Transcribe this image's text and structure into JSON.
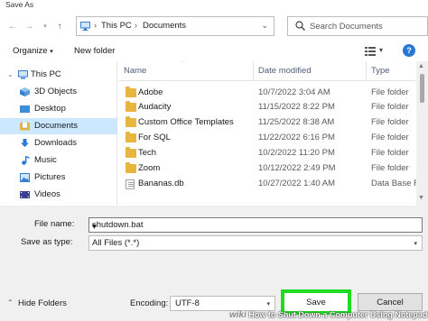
{
  "window": {
    "title": "Save As"
  },
  "address": {
    "crumbs": [
      "This PC",
      "Documents"
    ],
    "search_placeholder": "Search Documents"
  },
  "toolbar": {
    "organize": "Organize",
    "new_folder": "New folder"
  },
  "nav": {
    "items": [
      {
        "label": "This PC",
        "icon": "pc-icon"
      },
      {
        "label": "3D Objects",
        "icon": "cube-folder-icon"
      },
      {
        "label": "Desktop",
        "icon": "desktop-folder-icon"
      },
      {
        "label": "Documents",
        "icon": "documents-folder-icon",
        "selected": true
      },
      {
        "label": "Downloads",
        "icon": "downloads-folder-icon"
      },
      {
        "label": "Music",
        "icon": "music-folder-icon"
      },
      {
        "label": "Pictures",
        "icon": "pictures-folder-icon"
      },
      {
        "label": "Videos",
        "icon": "videos-folder-icon"
      }
    ]
  },
  "columns": {
    "name": "Name",
    "date": "Date modified",
    "type": "Type"
  },
  "files": [
    {
      "name": "Adobe",
      "date": "10/7/2022 3:04 AM",
      "type": "File folder",
      "icon": "folder-icon"
    },
    {
      "name": "Audacity",
      "date": "11/15/2022 8:22 PM",
      "type": "File folder",
      "icon": "folder-icon"
    },
    {
      "name": "Custom Office Templates",
      "date": "11/25/2022 8:38 AM",
      "type": "File folder",
      "icon": "folder-icon"
    },
    {
      "name": "For SQL",
      "date": "11/22/2022 6:16 PM",
      "type": "File folder",
      "icon": "folder-icon"
    },
    {
      "name": "Tech",
      "date": "10/2/2022 11:20 PM",
      "type": "File folder",
      "icon": "folder-icon"
    },
    {
      "name": "Zoom",
      "date": "10/12/2022 2:49 PM",
      "type": "File folder",
      "icon": "folder-icon"
    },
    {
      "name": "Bananas.db",
      "date": "10/27/2022 1:40 AM",
      "type": "Data Base File",
      "icon": "database-file-icon"
    }
  ],
  "form": {
    "file_name_label": "File name:",
    "file_name_value": "shutdown.bat",
    "save_as_type_label": "Save as type:",
    "save_as_type_value": "All Files (*.*)",
    "encoding_label": "Encoding:",
    "encoding_value": "UTF-8"
  },
  "buttons": {
    "hide_folders": "Hide Folders",
    "save": "Save",
    "cancel": "Cancel"
  },
  "watermark": {
    "brand": "wiki",
    "text": "How to Shut Down a Computer Using Notepad"
  },
  "colors": {
    "selected_nav": "#cce8ff",
    "save_highlight": "#1edc21",
    "folder": "#e8b63f",
    "header_text": "#4c607a"
  }
}
